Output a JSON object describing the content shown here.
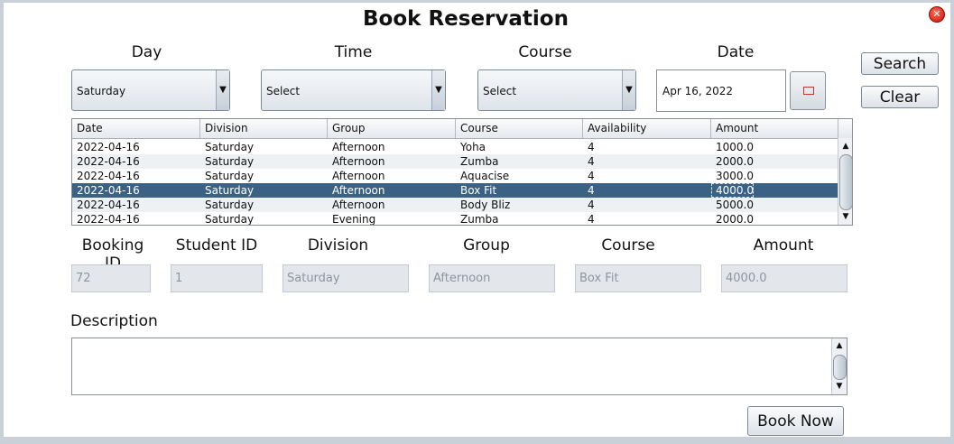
{
  "window": {
    "title": "Book Reservation",
    "close_icon": "close-icon"
  },
  "filters": {
    "day_label": "Day",
    "time_label": "Time",
    "course_label": "Course",
    "date_label": "Date",
    "day_value": "Saturday",
    "time_value": "Select",
    "course_value": "Select",
    "date_value": "Apr 16, 2022"
  },
  "buttons": {
    "search": "Search",
    "clear": "Clear",
    "book_now": "Book Now"
  },
  "table": {
    "columns": [
      "Date",
      "Division",
      "Group",
      "Course",
      "Availability",
      "Amount"
    ],
    "rows": [
      [
        "2022-04-16",
        "Saturday",
        "Afternoon",
        "Yoha",
        "4",
        "1000.0"
      ],
      [
        "2022-04-16",
        "Saturday",
        "Afternoon",
        "Zumba",
        "4",
        "2000.0"
      ],
      [
        "2022-04-16",
        "Saturday",
        "Afternoon",
        "Aquacise",
        "4",
        "3000.0"
      ],
      [
        "2022-04-16",
        "Saturday",
        "Afternoon",
        "Box Fit",
        "4",
        "4000.0"
      ],
      [
        "2022-04-16",
        "Saturday",
        "Afternoon",
        "Body Bliz",
        "4",
        "5000.0"
      ],
      [
        "2022-04-16",
        "Saturday",
        "Evening",
        "Zumba",
        "4",
        "2000.0"
      ]
    ],
    "selected_row": 3
  },
  "details": {
    "booking_id_label": "Booking ID",
    "booking_id": "72",
    "student_id_label": "Student ID",
    "student_id": "1",
    "division_label": "Division",
    "division": "Saturday",
    "group_label": "Group",
    "group": "Afternoon",
    "course_label": "Course",
    "course": "Box Fit",
    "amount_label": "Amount",
    "amount": "4000.0"
  },
  "description": {
    "label": "Description",
    "value": ""
  }
}
